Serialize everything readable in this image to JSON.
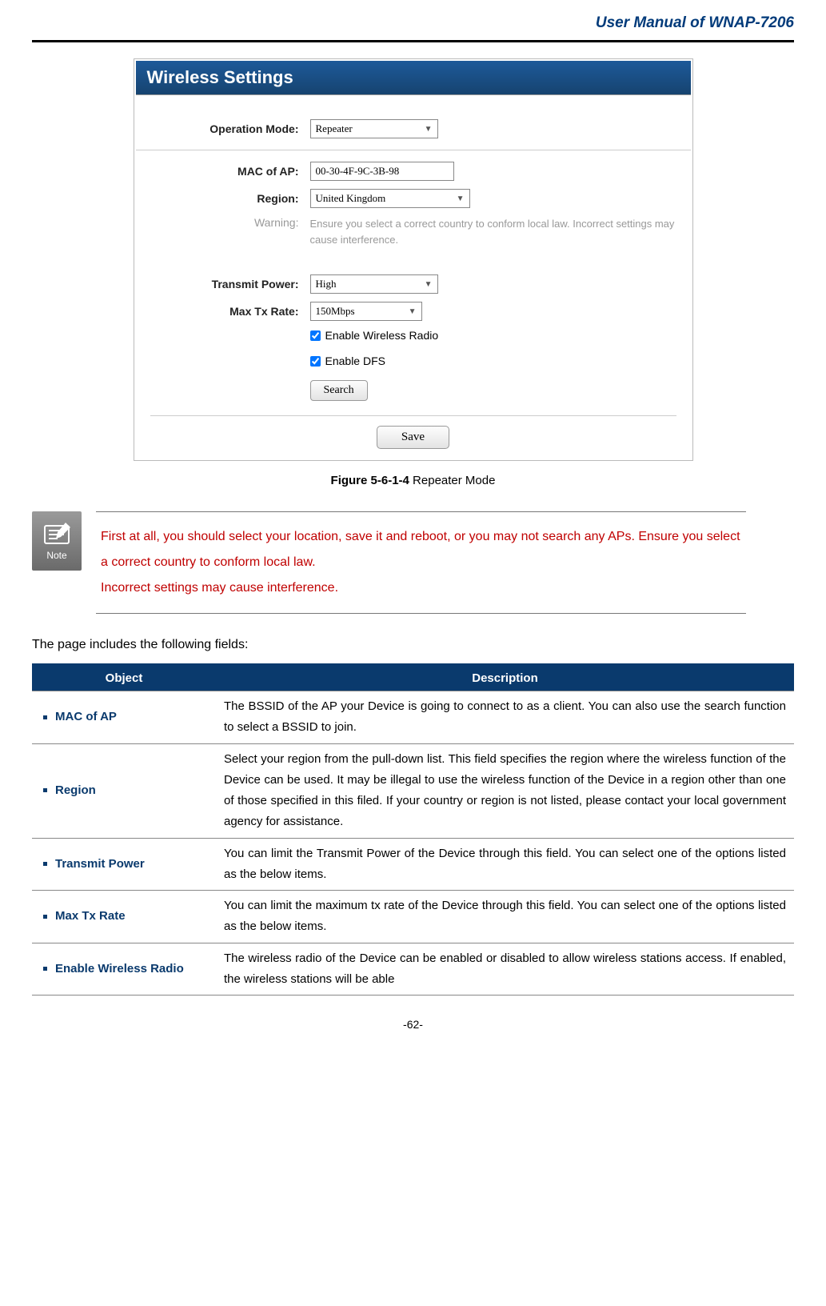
{
  "header": {
    "title": "User Manual of WNAP-7206"
  },
  "panel": {
    "title": "Wireless Settings",
    "operation_mode": {
      "label": "Operation Mode:",
      "value": "Repeater"
    },
    "mac_of_ap": {
      "label": "MAC of AP:",
      "value": "00-30-4F-9C-3B-98"
    },
    "region": {
      "label": "Region:",
      "value": "United Kingdom"
    },
    "warning": {
      "label": "Warning:",
      "text": "Ensure you select a correct country to conform local law. Incorrect settings may cause interference."
    },
    "transmit_power": {
      "label": "Transmit Power:",
      "value": "High"
    },
    "max_tx_rate": {
      "label": "Max Tx Rate:",
      "value": "150Mbps"
    },
    "enable_wireless_radio": {
      "label": "Enable Wireless Radio",
      "checked": true
    },
    "enable_dfs": {
      "label": "Enable DFS",
      "checked": true
    },
    "search_button": "Search",
    "save_button": "Save"
  },
  "figure": {
    "number": "Figure 5-6-1-4",
    "caption": " Repeater Mode"
  },
  "note": {
    "icon_label": "Note",
    "line1": "First at all, you should select your location, save it and reboot, or you may not search any APs. Ensure you select a correct country to conform local law.",
    "line2": "Incorrect settings may cause interference."
  },
  "intro": "The page includes the following fields:",
  "table": {
    "headers": {
      "object": "Object",
      "description": "Description"
    },
    "rows": [
      {
        "object": "MAC of AP",
        "description": "The BSSID of the AP your Device is going to connect to as a client. You can also use the search function to select a BSSID to join."
      },
      {
        "object": "Region",
        "description": "Select your region from the pull-down list. This field specifies the region where the wireless function of the Device can be used. It may be illegal to use the wireless function of the Device in a region other than one of those specified in this filed. If your country or region is not listed, please contact your local government agency for assistance."
      },
      {
        "object": "Transmit Power",
        "description": "You can limit the Transmit Power of the Device through this field. You can select one of the options listed as the below items."
      },
      {
        "object": "Max Tx Rate",
        "description": "You can limit the maximum tx rate of the Device through this field. You can select one of the options listed as the below items."
      },
      {
        "object": "Enable Wireless Radio",
        "description": "The wireless radio of the Device can be enabled or disabled to allow wireless stations access. If enabled, the wireless stations will be able"
      }
    ]
  },
  "footer": {
    "page": "-62-"
  }
}
